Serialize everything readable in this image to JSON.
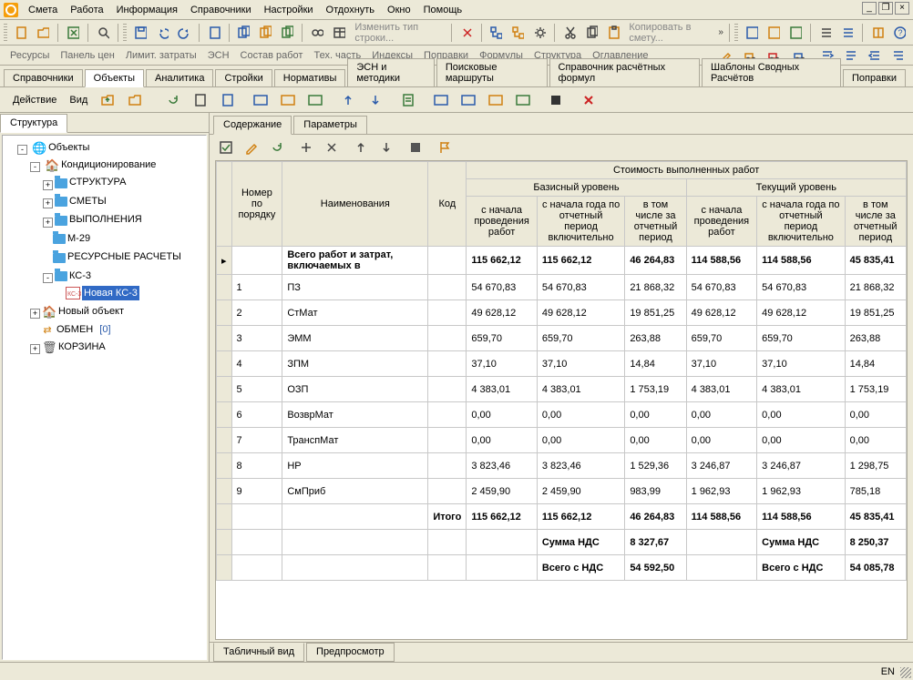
{
  "menu": {
    "items": [
      "Смета",
      "Работа",
      "Информация",
      "Справочники",
      "Настройки",
      "Отдохнуть",
      "Окно",
      "Помощь"
    ]
  },
  "toolbar1": {
    "text_change": "Изменить тип строки...",
    "text_copy": "Копировать в смету..."
  },
  "linktabs": [
    "Ресурсы",
    "Панель цен",
    "Лимит. затраты",
    "ЭСН",
    "Состав работ",
    "Тех. часть",
    "Индексы",
    "Поправки",
    "Формулы",
    "Структура",
    "Оглавление"
  ],
  "toptabs": [
    "Справочники",
    "Объекты",
    "Аналитика",
    "Стройки",
    "Нормативы",
    "ЭСН и методики",
    "Поисковые маршруты",
    "Справочник расчётных формул",
    "Шаблоны Сводных Расчётов",
    "Поправки"
  ],
  "toptabs_active": 1,
  "actionbar": {
    "labels": [
      "Действие",
      "Вид"
    ]
  },
  "lefttab": "Структура",
  "tree": {
    "root": "Объекты",
    "n1": "Кондиционирование",
    "c": [
      "СТРУКТУРА",
      "СМЕТЫ",
      "ВЫПОЛНЕНИЯ",
      "М-29",
      "РЕСУРСНЫЕ РАСЧЕТЫ",
      "КС-3"
    ],
    "ks3_badge": "КС-3",
    "ks3_item": "Новая КС-3",
    "n2": "Новый объект",
    "n3": "ОБМЕН",
    "n3_badge": "[0]",
    "n4": "КОРЗИНА"
  },
  "righttabs": [
    "Содержание",
    "Параметры"
  ],
  "table": {
    "sup": "Стоимость выполненных работ",
    "group1": "Базисный уровень",
    "group2": "Текущий уровень",
    "h_num": "Номер по порядку",
    "h_name": "Наименования",
    "h_code": "Код",
    "h_c1": "с начала проведения работ",
    "h_c2": "с начала года по отчетный период включительно",
    "h_c3": "в том числе за отчетный период",
    "total_label": "Всего работ и затрат, включаемых в",
    "rows": [
      {
        "n": "1",
        "name": "ПЗ",
        "v": [
          "54 670,83",
          "54 670,83",
          "21 868,32",
          "54 670,83",
          "54 670,83",
          "21 868,32"
        ]
      },
      {
        "n": "2",
        "name": "СтМат",
        "v": [
          "49 628,12",
          "49 628,12",
          "19 851,25",
          "49 628,12",
          "49 628,12",
          "19 851,25"
        ]
      },
      {
        "n": "3",
        "name": "ЭММ",
        "v": [
          "659,70",
          "659,70",
          "263,88",
          "659,70",
          "659,70",
          "263,88"
        ]
      },
      {
        "n": "4",
        "name": "ЗПМ",
        "v": [
          "37,10",
          "37,10",
          "14,84",
          "37,10",
          "37,10",
          "14,84"
        ]
      },
      {
        "n": "5",
        "name": "ОЗП",
        "v": [
          "4 383,01",
          "4 383,01",
          "1 753,19",
          "4 383,01",
          "4 383,01",
          "1 753,19"
        ]
      },
      {
        "n": "6",
        "name": "ВозврМат",
        "v": [
          "0,00",
          "0,00",
          "0,00",
          "0,00",
          "0,00",
          "0,00"
        ]
      },
      {
        "n": "7",
        "name": "ТранспМат",
        "v": [
          "0,00",
          "0,00",
          "0,00",
          "0,00",
          "0,00",
          "0,00"
        ]
      },
      {
        "n": "8",
        "name": "НР",
        "v": [
          "3 823,46",
          "3 823,46",
          "1 529,36",
          "3 246,87",
          "3 246,87",
          "1 298,75"
        ]
      },
      {
        "n": "9",
        "name": "СмПриб",
        "v": [
          "2 459,90",
          "2 459,90",
          "983,99",
          "1 962,93",
          "1 962,93",
          "785,18"
        ]
      }
    ],
    "top_vals": [
      "115 662,12",
      "115 662,12",
      "46 264,83",
      "114 588,56",
      "114 588,56",
      "45 835,41"
    ],
    "itogo_label": "Итого",
    "itogo_vals": [
      "115 662,12",
      "115 662,12",
      "46 264,83",
      "114 588,56",
      "114 588,56",
      "45 835,41"
    ],
    "nds_label": "Сумма НДС",
    "nds1": "8 327,67",
    "nds2": "8 250,37",
    "vnds_label": "Всего с НДС",
    "vnds1": "54 592,50",
    "vnds2": "54 085,78"
  },
  "bottomtabs": [
    "Табличный вид",
    "Предпросмотр"
  ],
  "status_lang": "EN"
}
